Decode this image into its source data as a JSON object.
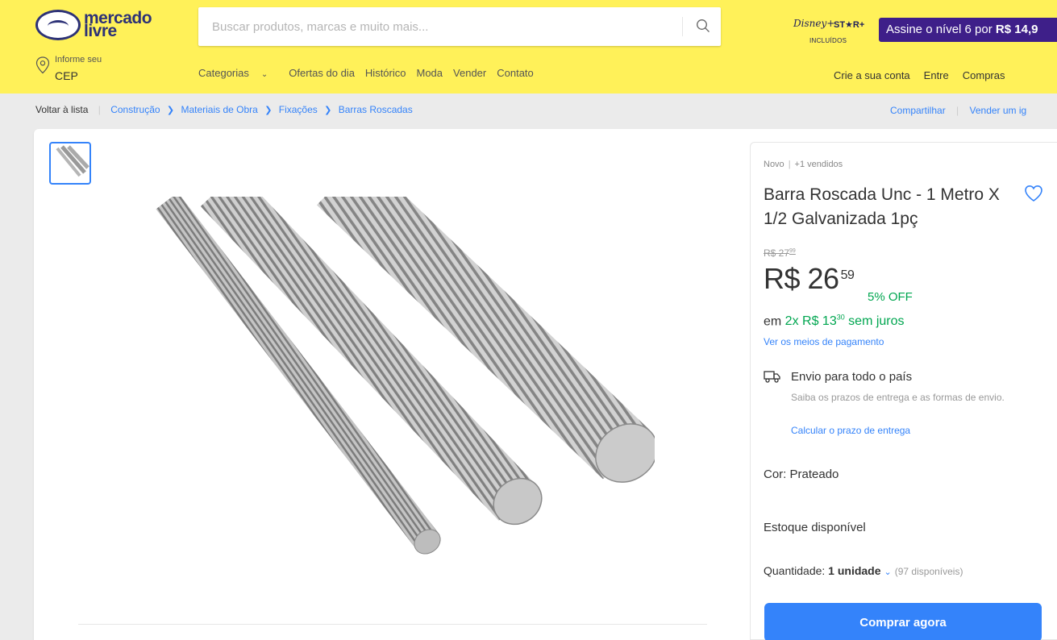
{
  "header": {
    "logo_line1": "mercado",
    "logo_line2": "livre",
    "search_placeholder": "Buscar produtos, marcas e muito mais...",
    "disney_line1": "Disney+",
    "disney_line2": "ST★R+",
    "disney_line3": "INCLUÍDOS",
    "promo_text": "Assine o nível 6 por ",
    "promo_price": "R$ 14,9",
    "cep_line1": "Informe seu",
    "cep_line2": "CEP",
    "nav": [
      "Categorias",
      "Ofertas do dia",
      "Histórico",
      "Moda",
      "Vender",
      "Contato"
    ],
    "nav_right": [
      "Crie a sua conta",
      "Entre",
      "Compras"
    ]
  },
  "breadcrumb": {
    "back": "Voltar à lista",
    "path": [
      "Construção",
      "Materiais de Obra",
      "Fixações",
      "Barras Roscadas"
    ],
    "share": "Compartilhar",
    "sell": "Vender um ig"
  },
  "product": {
    "condition": "Novo",
    "sold": "+1 vendidos",
    "title": "Barra Roscada Unc - 1 Metro X 1/2 Galvanizada 1pç",
    "old_price": "R$ 27",
    "old_cents": "99",
    "price": "R$ 26",
    "price_cents": "59",
    "discount": "5% OFF",
    "installments_prefix": "em ",
    "installments_value": "2x R$ 13",
    "installments_cents": "30",
    "installments_suffix": " sem juros",
    "payment_link": "Ver os meios de pagamento",
    "shipping_title": "Envio para todo o país",
    "shipping_sub": "Saiba os prazos de entrega e as formas de envio.",
    "shipping_link": "Calcular o prazo de entrega",
    "color_label": "Cor: ",
    "color_value": "Prateado",
    "stock": "Estoque disponível",
    "qty_label": "Quantidade: ",
    "qty_value": "1 unidade",
    "qty_available": "(97 disponíveis)",
    "buy_button": "Comprar agora"
  },
  "colors": {
    "header_bg": "#fff159",
    "accent": "#3483fa",
    "green": "#00a650",
    "promo_bg": "#3e1f89"
  }
}
